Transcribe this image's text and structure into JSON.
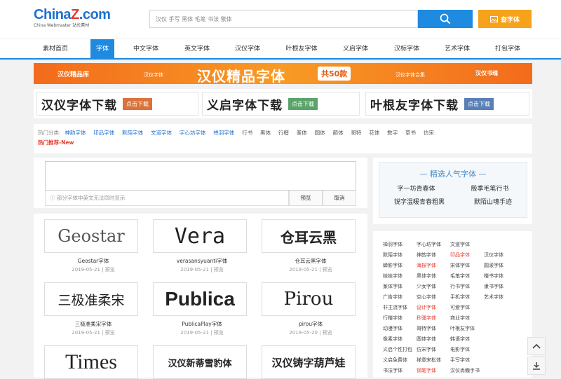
{
  "header": {
    "logo_text": "China",
    "logo_z": "Z",
    "logo_suffix": ".com",
    "logo_sub": "China Webmaster 站长素材",
    "search_placeholder": "汉仪 手写 黑体 毛笔 书法 繁体",
    "image_search_label": "查字体"
  },
  "nav": [
    "素材首页",
    "字体",
    "中文字体",
    "英文字体",
    "汉仪字体",
    "叶根友字体",
    "义启字体",
    "汉标字体",
    "艺术字体",
    "打包字体"
  ],
  "nav_active_index": 1,
  "banner": {
    "left_text": "汉仪精品库",
    "small_text": "汉仪字体",
    "main_text": "汉仪精品字体",
    "badge": "共50款",
    "small_text2": "汉仪字体合集",
    "right_text": "汉仪书魂"
  },
  "downloads": [
    {
      "title": "汉仪字体下载",
      "btn": "点击下载",
      "color": "#d9733a"
    },
    {
      "title": "义启字体下载",
      "btn": "点击下载",
      "color": "#5aa36a"
    },
    {
      "title": "叶根友字体下载",
      "btn": "点击下载",
      "color": "#5a7fb5"
    }
  ],
  "categories": {
    "label": "热门分类:",
    "blue": [
      "神韵字体",
      "印品字体",
      "默陌字体",
      "文道字体",
      "字心坊字体",
      "禅羽字体"
    ],
    "gray": [
      "行书",
      "黑体",
      "行楷",
      "篆体",
      "圆体",
      "颜体",
      "哥特",
      "花体",
      "数字",
      "草书",
      "仿宋"
    ],
    "hot": "热门推荐-New"
  },
  "preview": {
    "tip": "部分字体中英文无法同时显示",
    "preview_btn": "预览",
    "cancel_btn": "取消"
  },
  "fonts": [
    {
      "sample": "Geostar",
      "name": "Geostar字体",
      "date": "2019-05-21",
      "tag": "预览"
    },
    {
      "sample": "Vera",
      "name": "verasansyuanti字体",
      "date": "2019-05-21",
      "tag": "预览"
    },
    {
      "sample": "仓耳云黑",
      "name": "仓耳云黑字体",
      "date": "2019-05-21",
      "tag": "预览"
    },
    {
      "sample": "三极准柔宋",
      "name": "三极准柔宋字体",
      "date": "2019-05-21",
      "tag": "预览"
    },
    {
      "sample": "Publica",
      "name": "PublicaPlay字体",
      "date": "2019-05-21",
      "tag": "预览"
    },
    {
      "sample": "Pirou",
      "name": "pirou字体",
      "date": "2019-05-20",
      "tag": "预览"
    },
    {
      "sample": "Times",
      "name": "",
      "date": "",
      "tag": ""
    },
    {
      "sample": "汉仪新蒂雪豹体",
      "name": "",
      "date": "",
      "tag": ""
    },
    {
      "sample": "汉仪铸字葫芦娃",
      "name": "",
      "date": "",
      "tag": ""
    }
  ],
  "side_top": {
    "title": "精选人气字体",
    "line1": [
      "字一坊青春体",
      "殷季毛笔行书"
    ],
    "line2": [
      "锐字温暖青春粗黑",
      "默陌山魂手迹"
    ]
  },
  "side_list": [
    [
      "禅羽字体",
      "字心坊字体",
      "文道字体"
    ],
    [
      "默陌字体",
      "神韵字体",
      "印品字体",
      "汉仪字体"
    ],
    [
      "蝉影字体",
      "海报字体",
      "宋体字体",
      "圆滚字体"
    ],
    [
      "娃娃字体",
      "黑体字体",
      "毛笔字体",
      "楷书字体"
    ],
    [
      "篆体字体",
      "少女字体",
      "行书字体",
      "隶书字体"
    ],
    [
      "广告字体",
      "空心字体",
      "手机字体",
      "艺术字体"
    ],
    [
      "非主流字体",
      "设计字体",
      "可爱字体"
    ],
    [
      "行楷字体",
      "秒骚字体",
      "商业字体"
    ],
    [
      "动漫字体",
      "哥特字体",
      "叶根友字体"
    ],
    [
      "像素字体",
      "圆体字体",
      "韩语字体"
    ],
    [
      "义启个性打包",
      "仿宋字体",
      "电影字体"
    ],
    [
      "义启免费体",
      "禅意宋松体",
      "手写字体"
    ],
    [
      "书法字体",
      "钢笔字体",
      "汉仪尚巍手书"
    ]
  ],
  "side_list_red": [
    [
      1,
      2
    ],
    [
      2,
      1
    ],
    [
      6,
      1
    ],
    [
      7,
      1
    ],
    [
      12,
      1
    ]
  ],
  "colors": {
    "brand_blue": "#1e8ae0",
    "accent_orange": "#f7a21b",
    "hot_red": "#e63a2e"
  },
  "icons": {
    "search": "search-icon",
    "image": "image-icon",
    "up": "chevron-up-icon",
    "download": "download-icon",
    "info": "info-icon"
  }
}
